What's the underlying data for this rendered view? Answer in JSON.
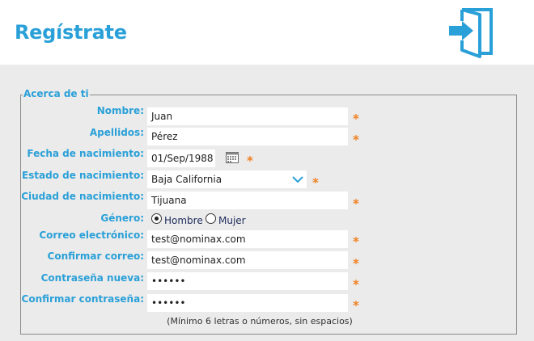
{
  "header": {
    "title": "Regístrate",
    "icon": "login-door-icon",
    "accent": "#2aa0d8"
  },
  "section": {
    "legend": "Acerca de ti"
  },
  "fields": {
    "nombre": {
      "label": "Nombre:",
      "value": "Juan"
    },
    "apellidos": {
      "label": "Apellidos:",
      "value": "Pérez"
    },
    "fecha": {
      "label": "Fecha de nacimiento:",
      "value": "01/Sep/1988",
      "icon": "calendar-icon"
    },
    "estado": {
      "label": "Estado de nacimiento:",
      "value": "Baja California",
      "icon": "chevron-down-icon"
    },
    "ciudad": {
      "label": "Ciudad de nacimiento:",
      "value": "Tijuana"
    },
    "genero": {
      "label": "Género:",
      "options": [
        "Hombre",
        "Mujer"
      ],
      "selected": "Hombre"
    },
    "correo": {
      "label": "Correo electrónico:",
      "value": "test@nominax.com"
    },
    "confirmar_correo": {
      "label": "Confirmar correo:",
      "value": "test@nominax.com"
    },
    "contrasena": {
      "label": "Contraseña nueva:",
      "value": "••••••"
    },
    "confirmar_contrasena": {
      "label": "Confirmar contraseña:",
      "value": "••••••"
    }
  },
  "required_mark": "*",
  "password_hint": "(Mínimo 6 letras o números, sin espacios)",
  "colors": {
    "label": "#2aa0d8",
    "required": "#f08020",
    "background": "#ebebeb"
  }
}
